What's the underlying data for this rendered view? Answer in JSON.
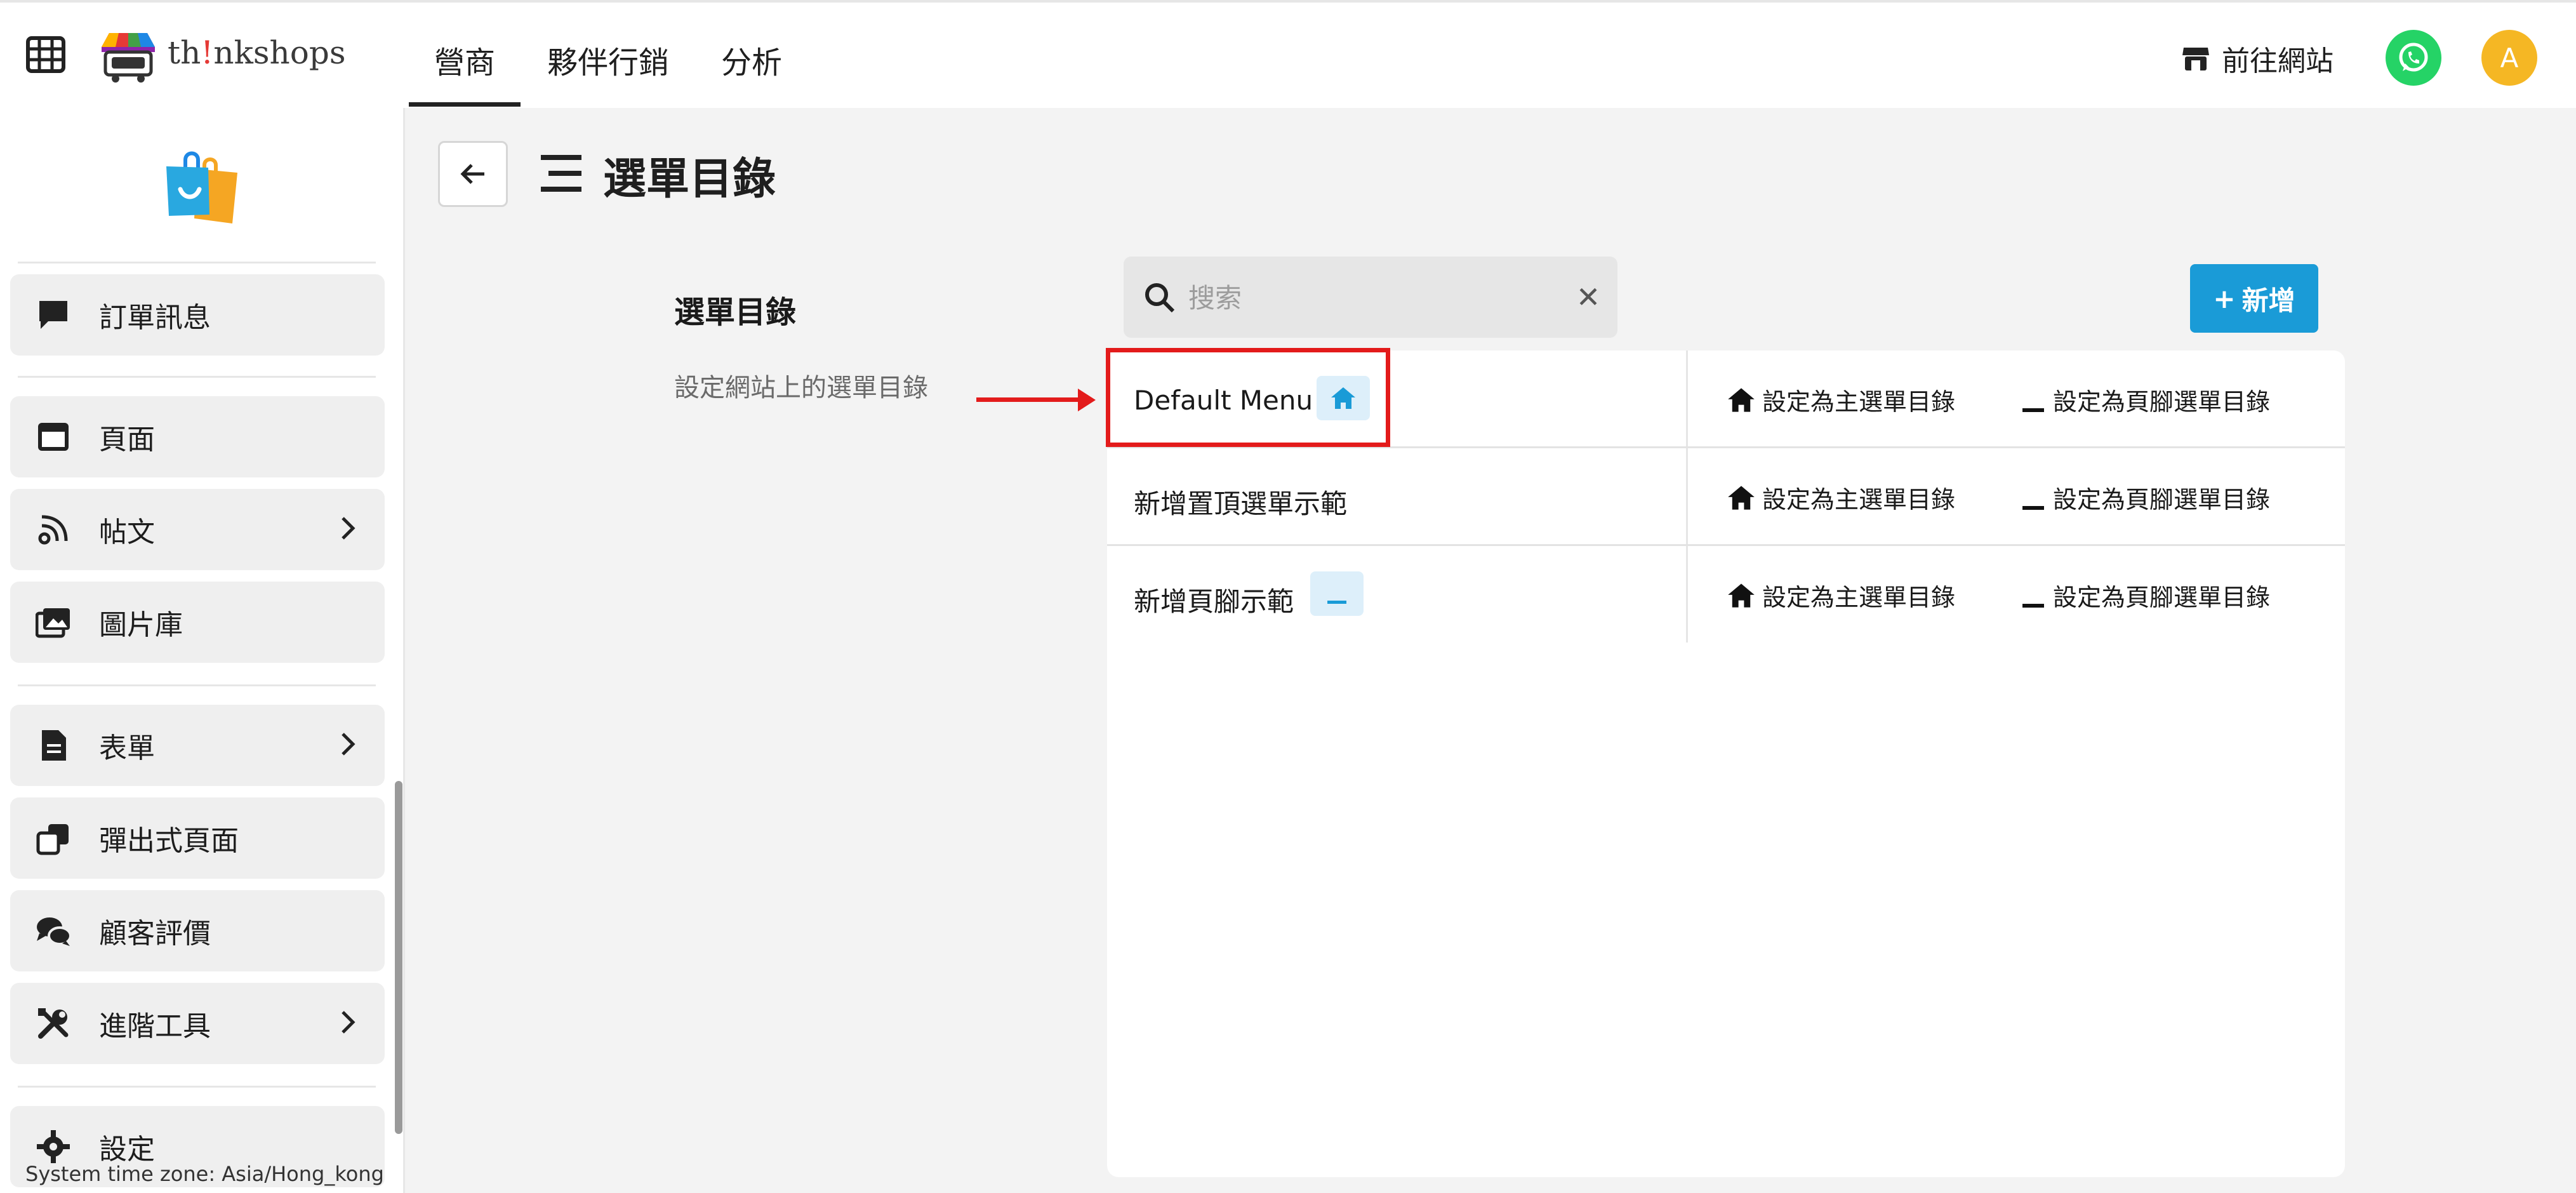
{
  "nav": {
    "logo_prefix": "th",
    "logo_em": "!",
    "logo_suffix": "nkshops",
    "tabs": [
      {
        "label": "營商",
        "active": true
      },
      {
        "label": "夥伴行銷",
        "active": false
      },
      {
        "label": "分析",
        "active": false
      }
    ],
    "visit_site": "前往網站",
    "avatar_initial": "A"
  },
  "sidebar": {
    "items": [
      {
        "label": "訂單訊息",
        "icon": "chat-bubble-icon",
        "has_submenu": false
      },
      {
        "label": "頁面",
        "icon": "page-icon",
        "has_submenu": false
      },
      {
        "label": "帖文",
        "icon": "rss-icon",
        "has_submenu": true
      },
      {
        "label": "圖片庫",
        "icon": "image-library-icon",
        "has_submenu": false
      },
      {
        "label": "表單",
        "icon": "form-icon",
        "has_submenu": true
      },
      {
        "label": "彈出式頁面",
        "icon": "popup-icon",
        "has_submenu": false
      },
      {
        "label": "顧客評價",
        "icon": "reviews-icon",
        "has_submenu": false
      },
      {
        "label": "進階工具",
        "icon": "tools-icon",
        "has_submenu": true
      },
      {
        "label": "設定",
        "icon": "gear-icon",
        "has_submenu": false
      }
    ],
    "timezone": "System time zone: Asia/Hong_kong"
  },
  "page": {
    "title": "選單目錄",
    "section_title": "選單目錄",
    "section_desc": "設定網站上的選單目錄",
    "search_placeholder": "搜索",
    "add_label": "新增"
  },
  "menus": [
    {
      "name": "Default Menu",
      "badge": "home",
      "action_main": "設定為主選單目錄",
      "action_footer": "設定為頁腳選單目錄"
    },
    {
      "name": "新增置頂選單示範",
      "badge": "",
      "action_main": "設定為主選單目錄",
      "action_footer": "設定為頁腳選單目錄"
    },
    {
      "name": "新增頁腳示範",
      "badge": "footer",
      "action_main": "設定為主選單目錄",
      "action_footer": "設定為頁腳選單目錄"
    }
  ],
  "colors": {
    "accent": "#1a9bd7",
    "highlight": "#e31b1b",
    "whatsapp": "#25d366",
    "avatar": "#f5b724"
  }
}
